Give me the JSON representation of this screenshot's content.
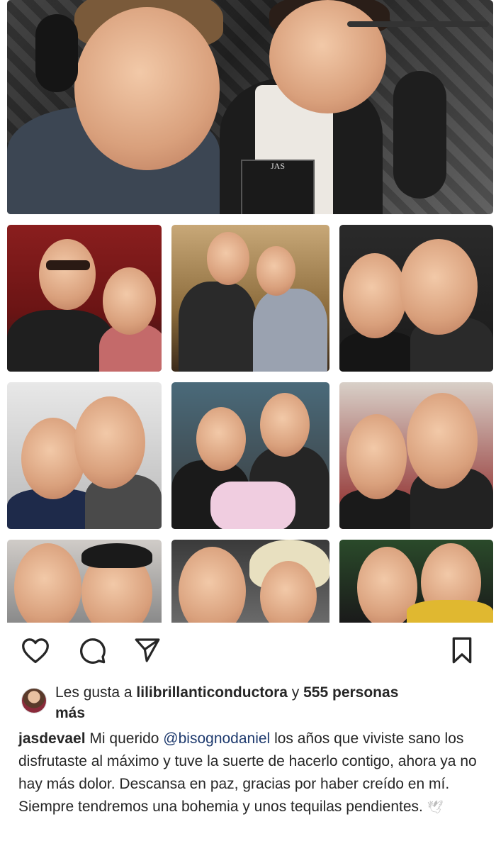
{
  "photos": {
    "hero": {
      "description_icon": "studio-photo-icon",
      "album_text": "JAS"
    },
    "grid": [
      {
        "name": "photo-1"
      },
      {
        "name": "photo-2"
      },
      {
        "name": "photo-3"
      },
      {
        "name": "photo-4"
      },
      {
        "name": "photo-5"
      },
      {
        "name": "photo-6"
      },
      {
        "name": "photo-7"
      },
      {
        "name": "photo-8"
      },
      {
        "name": "photo-9"
      }
    ]
  },
  "actions": {
    "like_icon": "heart-icon",
    "comment_icon": "comment-icon",
    "share_icon": "send-icon",
    "save_icon": "bookmark-icon"
  },
  "likes": {
    "prefix": "Les gusta a ",
    "user": "lilibrillanticonductora",
    "middle": " y ",
    "count": "555 personas",
    "suffix": "más"
  },
  "caption": {
    "username": "jasdevael",
    "text_before": " Mi querido ",
    "mention": "@bisognodaniel",
    "text_after": " los años que viviste sano los disfrutaste al máximo y tuve la suerte de hacerlo contigo, ahora ya no hay más dolor. Descansa en paz, gracias por haber creído en mí. Siempre tendremos una bohemia y unos tequilas pendientes. ",
    "emoji": "🕊"
  },
  "colors": {
    "mention": "#1e3a6e",
    "text": "#262626",
    "background": "#ffffff"
  }
}
